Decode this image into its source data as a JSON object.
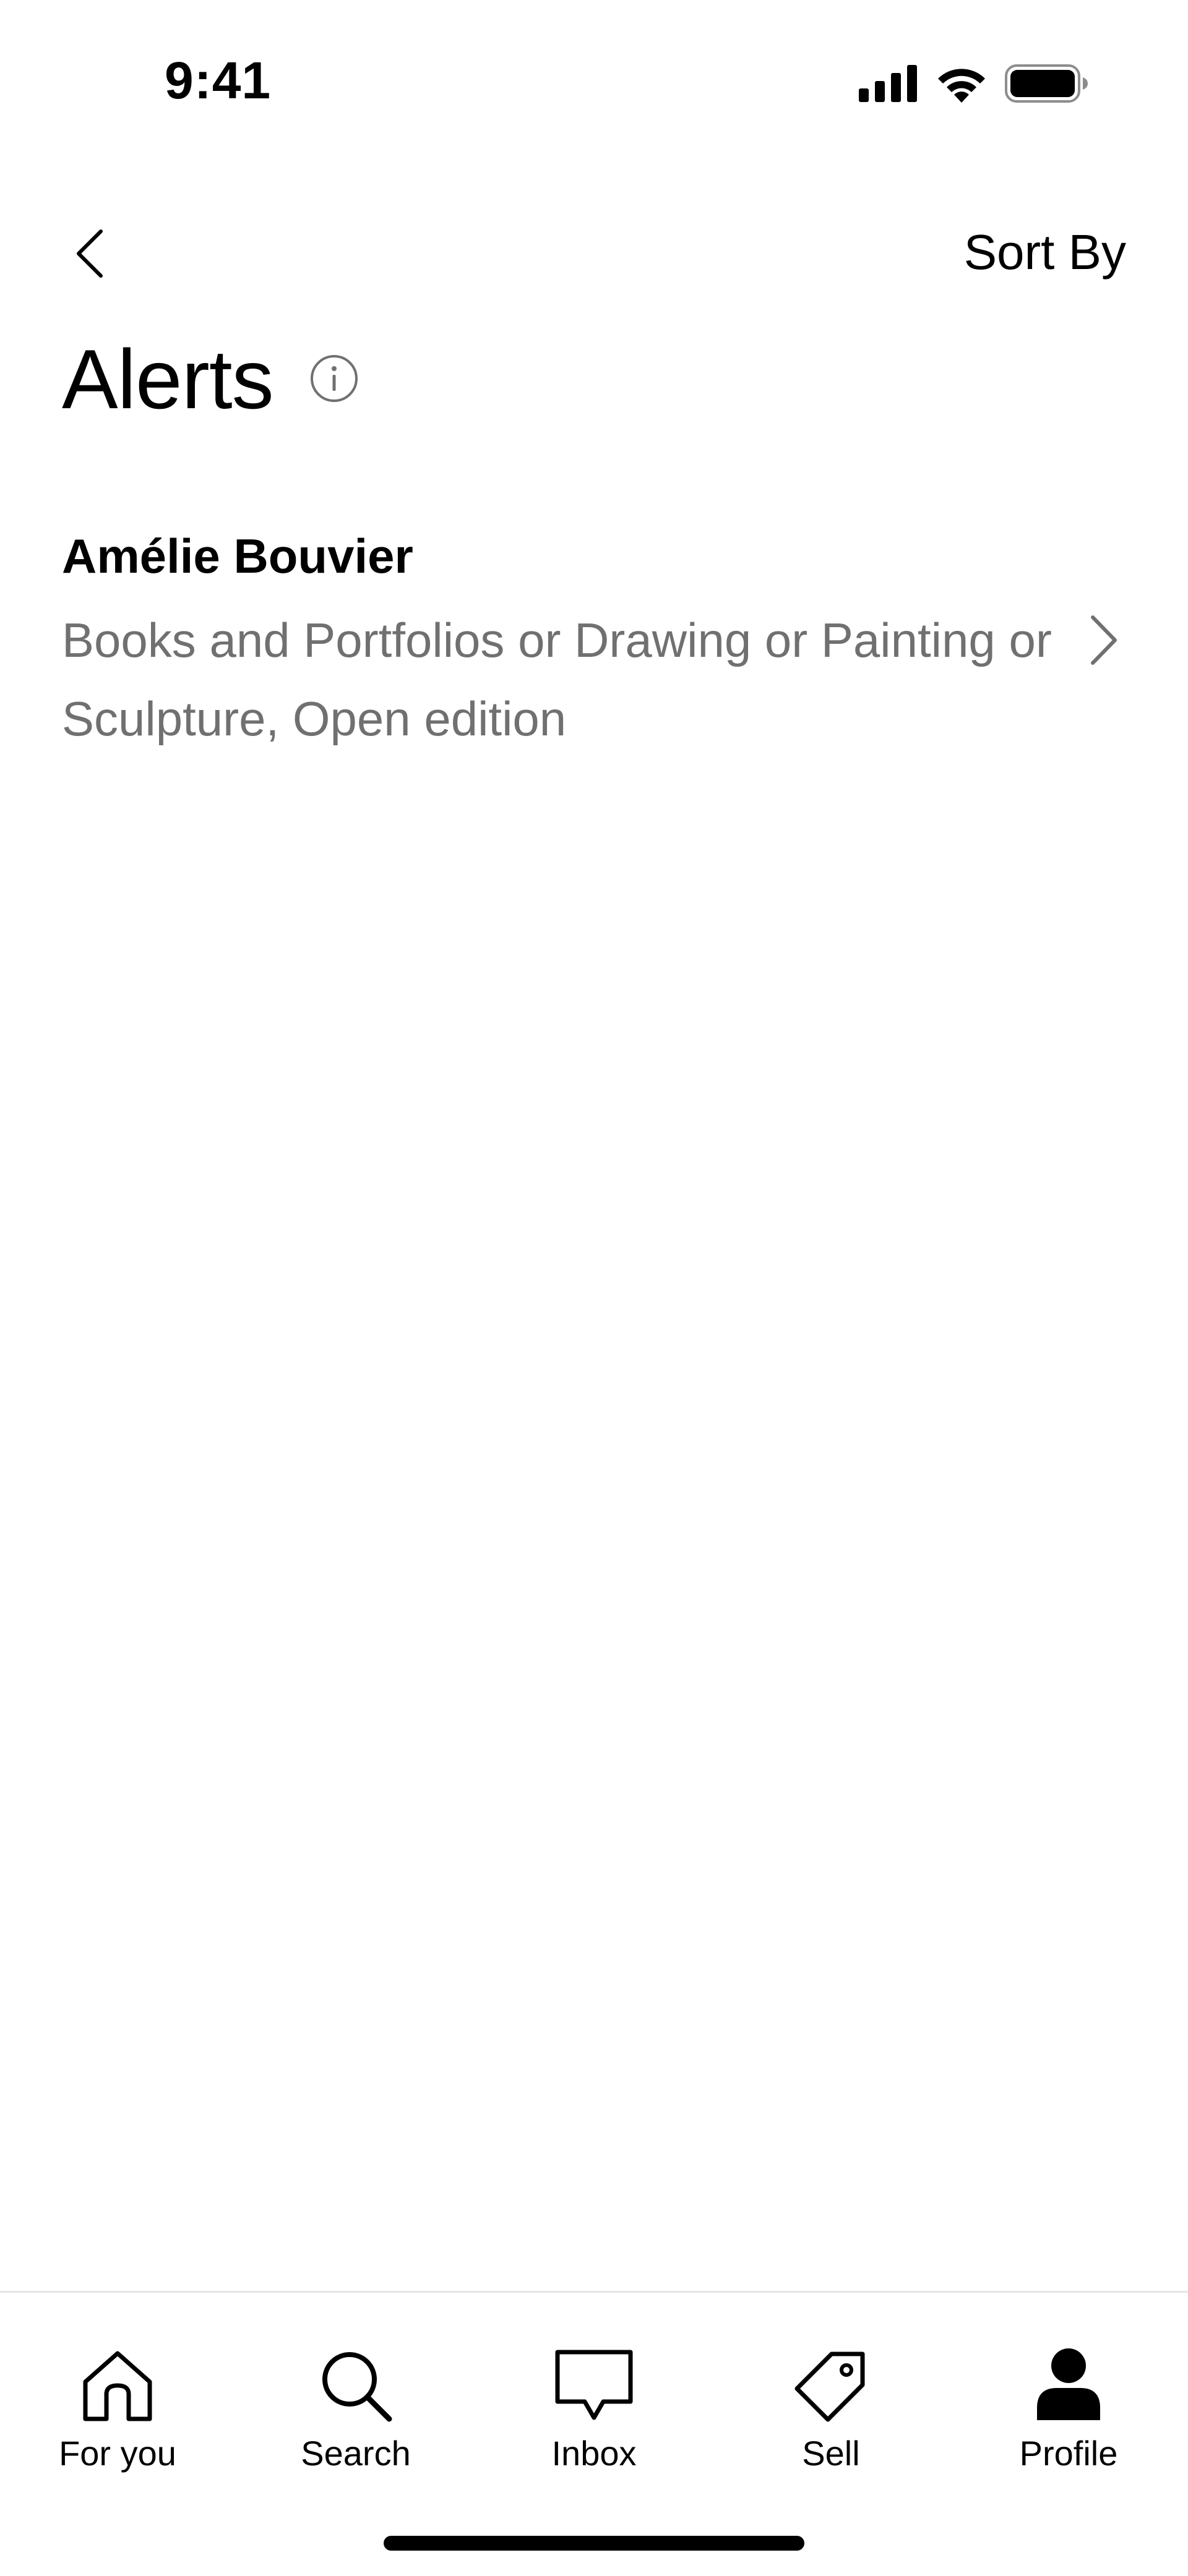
{
  "status_bar": {
    "time": "9:41",
    "icons": [
      "cellular-signal-icon",
      "wifi-icon",
      "battery-icon"
    ]
  },
  "header": {
    "back_icon": "chevron-left-icon",
    "sort_label": "Sort By",
    "title": "Alerts",
    "info_icon": "info-icon"
  },
  "alerts": [
    {
      "name": "Amélie Bouvier",
      "criteria": "Books and Portfolios or Drawing or Painting or Sculpture, Open edition",
      "icon": "chevron-right-icon"
    }
  ],
  "tab_bar": {
    "tabs": [
      {
        "label": "For you",
        "icon": "home-icon",
        "active": false
      },
      {
        "label": "Search",
        "icon": "search-icon",
        "active": false
      },
      {
        "label": "Inbox",
        "icon": "chat-bubble-icon",
        "active": false
      },
      {
        "label": "Sell",
        "icon": "tag-icon",
        "active": false
      },
      {
        "label": "Profile",
        "icon": "person-icon",
        "active": true
      }
    ]
  },
  "colors": {
    "text_primary": "#000000",
    "text_secondary": "#707070",
    "divider": "#e5e5e5",
    "background": "#ffffff"
  }
}
